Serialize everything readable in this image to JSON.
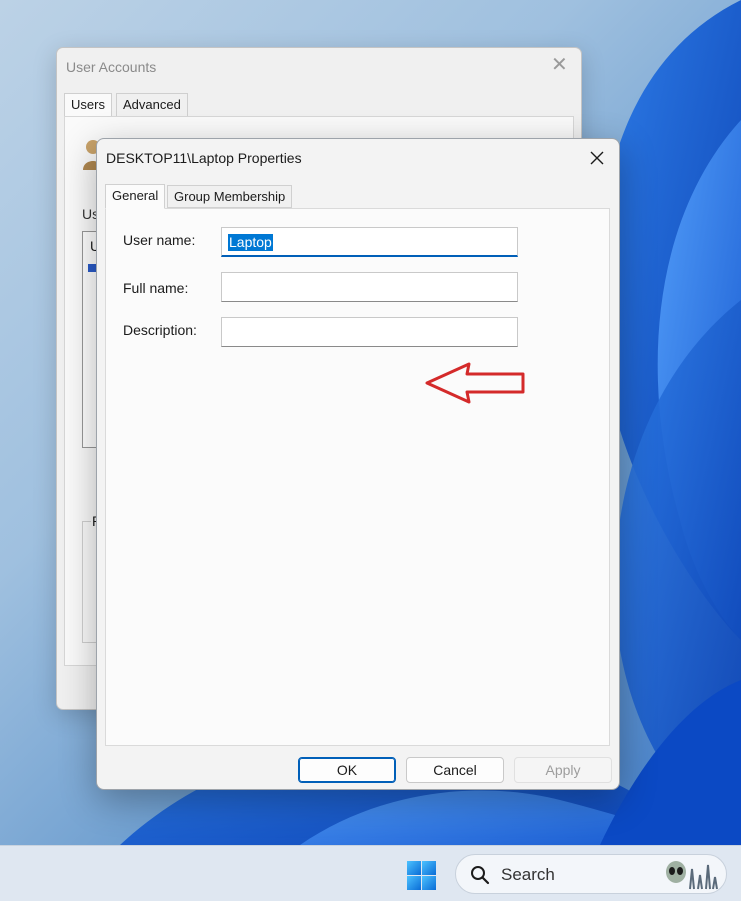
{
  "background_window": {
    "title": "User Accounts",
    "tabs": [
      {
        "label": "Users",
        "active": true
      },
      {
        "label": "Advanced",
        "active": false
      }
    ],
    "fragments": {
      "users_label": "Us",
      "list_header": "U",
      "group_label": "P"
    }
  },
  "dialog": {
    "title": "DESKTOP11\\Laptop Properties",
    "tabs": [
      {
        "label": "General",
        "active": true
      },
      {
        "label": "Group Membership",
        "active": false
      }
    ],
    "fields": {
      "user_name": {
        "label": "User name:",
        "value": "Laptop",
        "selected": true
      },
      "full_name": {
        "label": "Full name:",
        "value": ""
      },
      "description": {
        "label": "Description:",
        "value": ""
      }
    },
    "buttons": {
      "ok": "OK",
      "cancel": "Cancel",
      "apply": "Apply"
    }
  },
  "taskbar": {
    "search_placeholder": "Search"
  },
  "colors": {
    "accent": "#0078d4",
    "arrow": "#d42a2a"
  },
  "icons": {
    "close": "close-icon",
    "start": "windows-start-icon",
    "search": "search-icon",
    "annotation": "red-arrow-left"
  }
}
